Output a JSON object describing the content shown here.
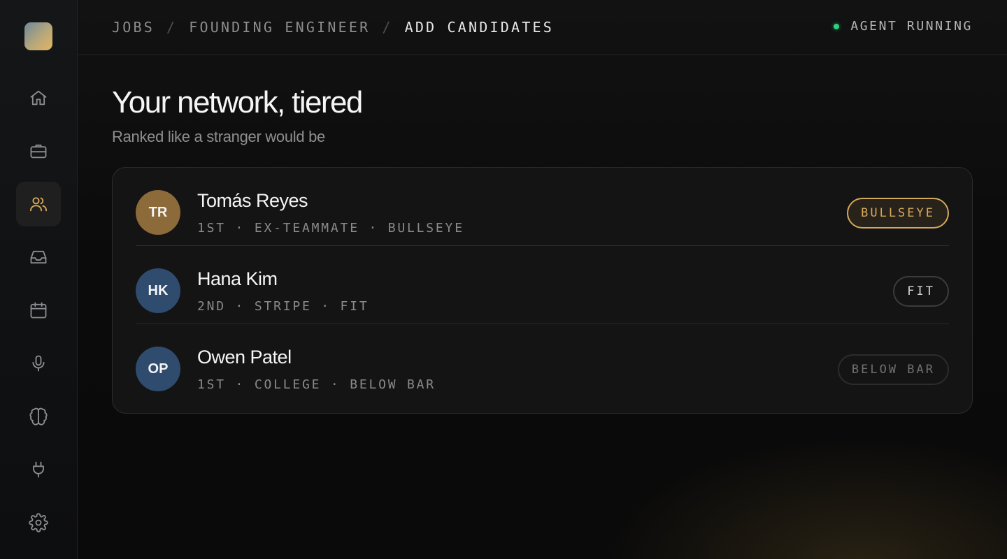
{
  "breadcrumb": {
    "items": [
      "JOBS",
      "FOUNDING ENGINEER"
    ],
    "separator": "/",
    "current": "ADD CANDIDATES"
  },
  "agent": {
    "status_label": "AGENT RUNNING",
    "status_color": "#30d17c"
  },
  "sidebar": {
    "items": [
      {
        "icon": "home-icon"
      },
      {
        "icon": "briefcase-icon"
      },
      {
        "icon": "users-icon",
        "active": true
      },
      {
        "icon": "inbox-icon"
      },
      {
        "icon": "calendar-icon"
      },
      {
        "icon": "microphone-icon"
      },
      {
        "icon": "brain-icon"
      },
      {
        "icon": "plug-icon"
      },
      {
        "icon": "settings-icon"
      }
    ],
    "accent_color": "#d6a85a"
  },
  "main": {
    "title": "Your network, tiered",
    "subtitle": "Ranked like a stranger would be"
  },
  "candidates": [
    {
      "initials": "TR",
      "name": "Tomás Reyes",
      "meta": "1ST · EX-TEAMMATE · BULLSEYE",
      "tier": "BULLSEYE",
      "avatar_color": "#8c6a3a",
      "tier_color": "#d6a85a"
    },
    {
      "initials": "HK",
      "name": "Hana Kim",
      "meta": "2ND · STRIPE · FIT",
      "tier": "FIT",
      "avatar_color": "#2f4b6e",
      "tier_color": "#d6d6d6"
    },
    {
      "initials": "OP",
      "name": "Owen Patel",
      "meta": "1ST · COLLEGE · BELOW BAR",
      "tier": "BELOW BAR",
      "avatar_color": "#2f4b6e",
      "tier_color": "#6f6f6f"
    }
  ]
}
